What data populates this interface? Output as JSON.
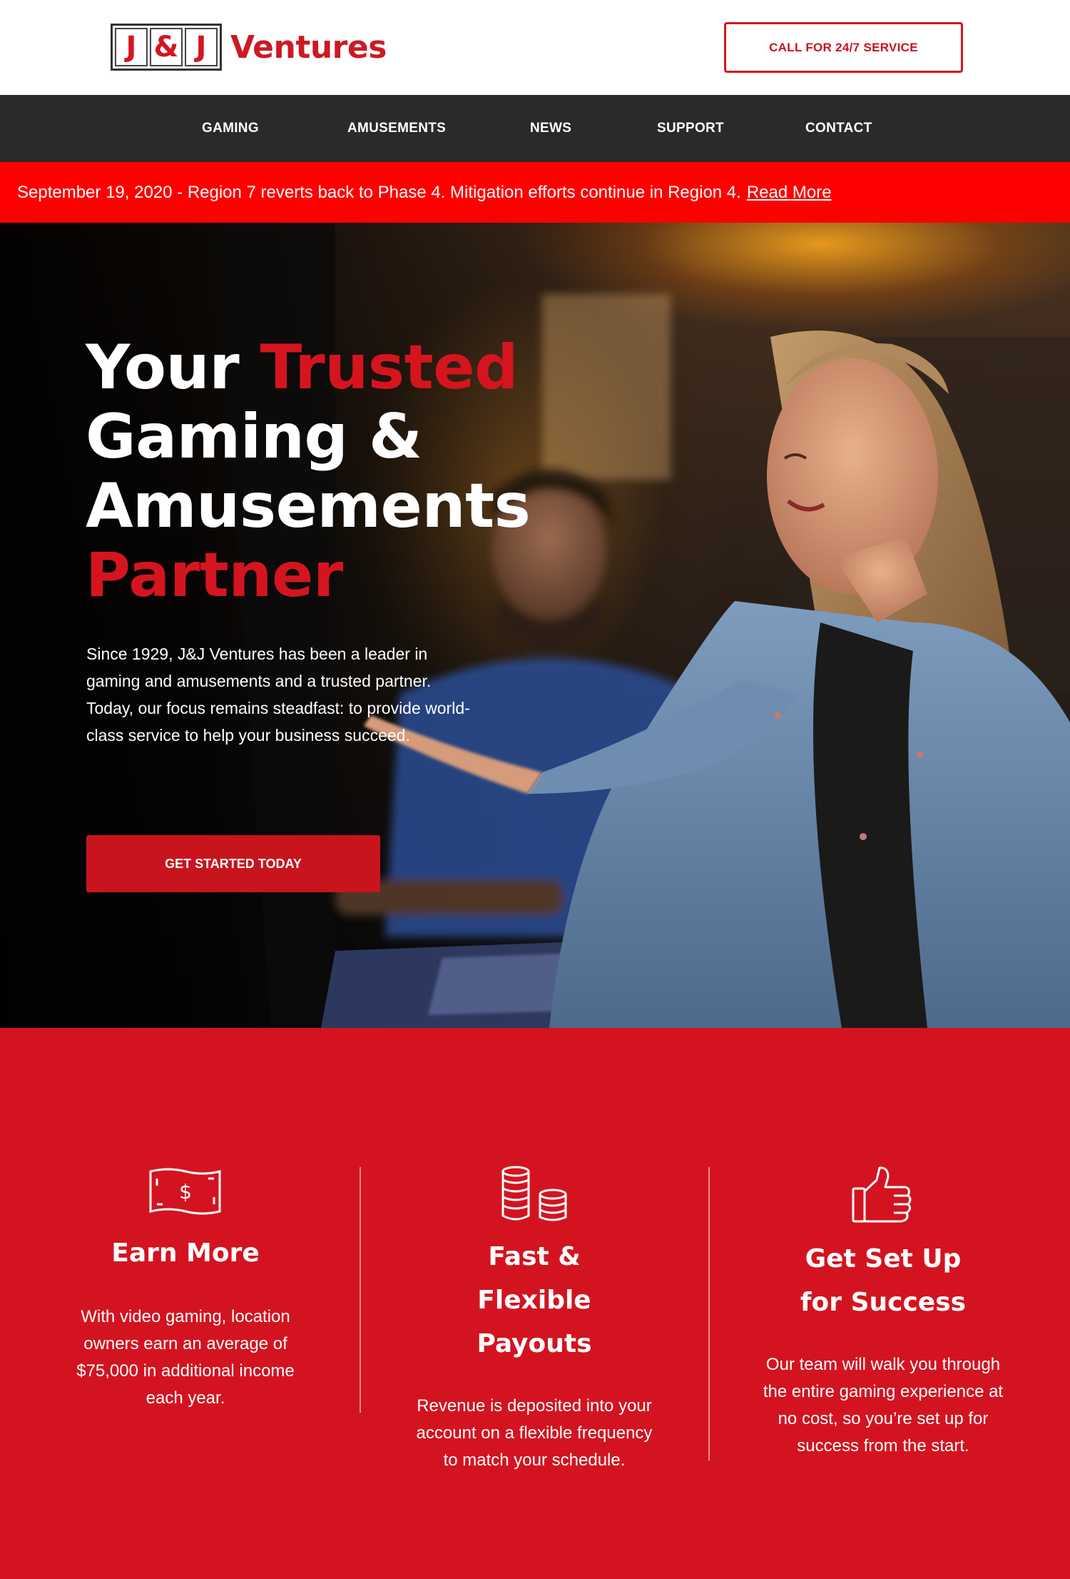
{
  "header": {
    "logo_letters": [
      "J",
      "&",
      "J"
    ],
    "logo_word": "Ventures",
    "call_button": "CALL FOR 24/7 SERVICE"
  },
  "nav": {
    "items": [
      {
        "label": "GAMING"
      },
      {
        "label": "AMUSEMENTS"
      },
      {
        "label": "NEWS"
      },
      {
        "label": "SUPPORT"
      },
      {
        "label": "CONTACT"
      }
    ]
  },
  "alert": {
    "text": "September 19, 2020 - Region 7 reverts back to Phase 4. Mitigation efforts continue in Region 4.",
    "link": "Read More"
  },
  "hero": {
    "title_word1": "Your",
    "title_word2": "Trusted",
    "title_line2": "Gaming &",
    "title_line3": "Amusements",
    "title_line4": "Partner",
    "description": "Since 1929, J&J Ventures has been a leader in gaming and amusements and a trusted partner. Today, our focus remains steadfast: to provide world-class service to help your business succeed.",
    "cta": "GET STARTED TODAY"
  },
  "features": [
    {
      "icon": "money-bill-icon",
      "title": "Earn More",
      "text": "With video gaming, location owners earn an average of $75,000 in additional income each year."
    },
    {
      "icon": "coins-icon",
      "title": "Fast & Flexible Payouts",
      "text": "Revenue is deposited into your account on a flexible frequency to match your schedule."
    },
    {
      "icon": "thumbs-up-icon",
      "title": "Get Set Up for Success",
      "text": "Our team will walk you through the entire gaming experience at no cost, so you’re set up for success from the start."
    }
  ],
  "colors": {
    "brand_red": "#d31420",
    "alert_red": "#ff0000",
    "nav_bg": "#2a2a28"
  }
}
